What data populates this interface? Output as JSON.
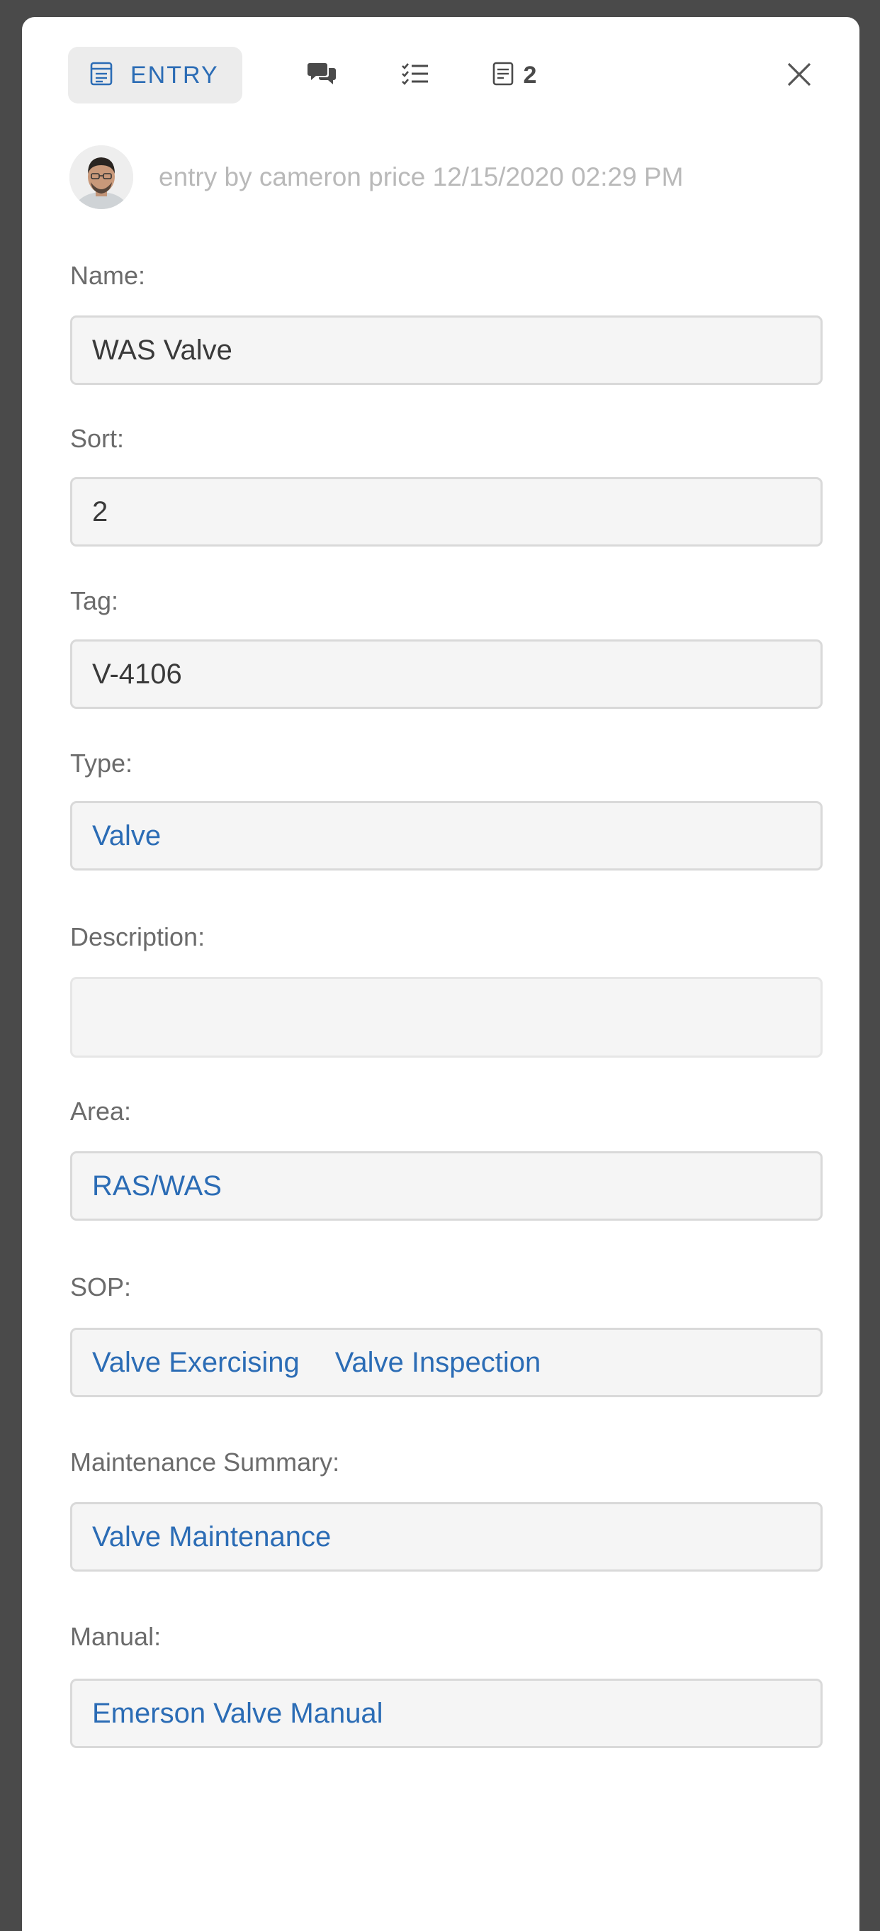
{
  "tabs": {
    "entry_label": "ENTRY",
    "docs_count": "2"
  },
  "author": {
    "text": "entry by cameron price 12/15/2020 02:29 PM"
  },
  "fields": {
    "name": {
      "label": "Name:",
      "value": "WAS Valve"
    },
    "sort": {
      "label": "Sort:",
      "value": "2"
    },
    "tag": {
      "label": "Tag:",
      "value": "V-4106"
    },
    "type": {
      "label": "Type:",
      "value": "Valve"
    },
    "description": {
      "label": "Description:",
      "value": ""
    },
    "area": {
      "label": "Area:",
      "value": "RAS/WAS"
    },
    "sop": {
      "label": "SOP:",
      "values": [
        "Valve Exercising",
        "Valve Inspection"
      ]
    },
    "maintenance_summary": {
      "label": "Maintenance Summary:",
      "value": "Valve Maintenance"
    },
    "manual": {
      "label": "Manual:",
      "value": "Emerson Valve Manual"
    }
  },
  "colors": {
    "accent": "#2b6cb5",
    "backdrop": "#4a4a4a",
    "field_bg": "#f5f5f5",
    "field_border": "#d9d9d9",
    "muted_text": "#b9b9b9"
  },
  "icons": {
    "entry_tab": "form-icon",
    "comments_tab": "comments-icon",
    "checklist_tab": "checklist-icon",
    "docs_tab": "document-icon",
    "close": "close-icon"
  }
}
